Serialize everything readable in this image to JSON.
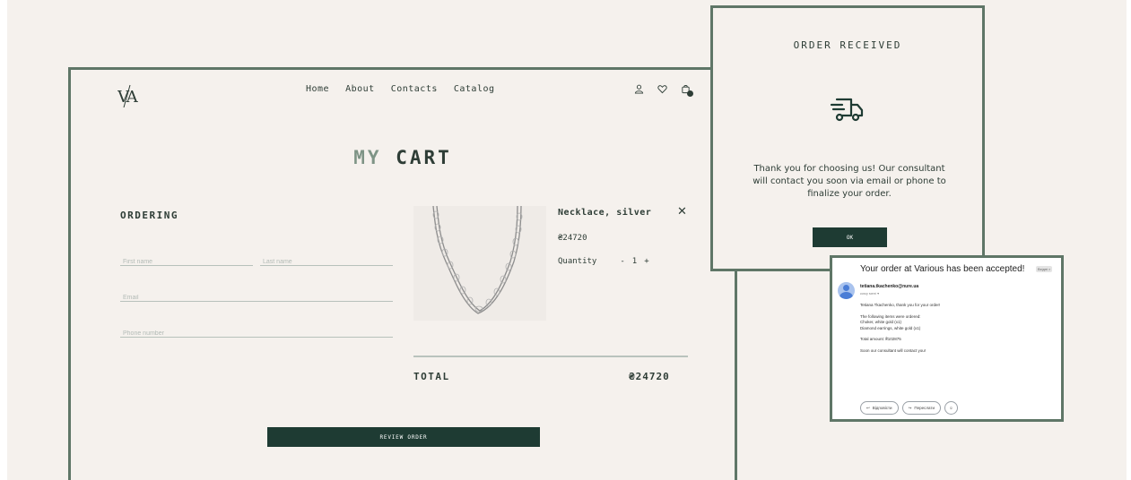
{
  "header": {
    "logo_text": "VA",
    "nav": [
      "Home",
      "About",
      "Contacts",
      "Catalog"
    ]
  },
  "page_title": {
    "light": "MY",
    "bold": "CART"
  },
  "ordering": {
    "title": "ORDERING",
    "first_name_placeholder": "First name",
    "last_name_placeholder": "Last name",
    "email_placeholder": "Email",
    "phone_placeholder": "Phone number"
  },
  "cart_item": {
    "name": "Necklace, silver",
    "price": "₴24720",
    "quantity_label": "Quantity",
    "quantity_minus": "-",
    "quantity_value": "1",
    "quantity_plus": "+",
    "remove_symbol": "✕"
  },
  "total": {
    "label": "TOTAL",
    "value": "₴24720"
  },
  "review_button": "REVIEW ORDER",
  "modal": {
    "title": "ORDER RECEIVED",
    "message": "Thank you for choosing us! Our consultant will contact you soon via email or phone to finalize your order.",
    "ok_button": "OK"
  },
  "email": {
    "subject": "Your order at Various has been accepted!",
    "tag": "Вхідні ×",
    "sender": "tetiana.tkachenko@nure.ua",
    "to": "кому мені ▾",
    "body": [
      "Tetiana Tkachenko, thank you for your order!",
      "",
      "The following items were ordered:",
      "Choker, white gold (x1)",
      "Diamond earrings, white gold (x1)",
      "",
      "Total amount: ₴102875",
      "",
      "Soon our consultant will contact you!"
    ],
    "reply_label": "Відповісти",
    "forward_label": "Переслати"
  },
  "colors": {
    "background": "#f5f1ed",
    "accent_dark": "#1e3b33",
    "frame": "#5f7667"
  }
}
